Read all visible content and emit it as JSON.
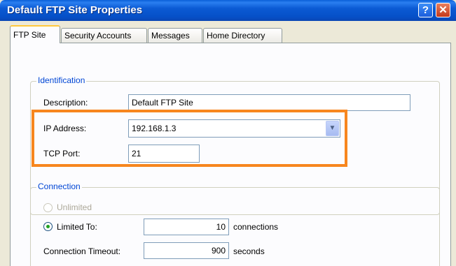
{
  "window": {
    "title": "Default FTP Site Properties",
    "help_glyph": "?",
    "close_glyph": "✕"
  },
  "tabs": [
    {
      "label": "FTP Site",
      "active": true
    },
    {
      "label": "Security Accounts",
      "active": false
    },
    {
      "label": "Messages",
      "active": false
    },
    {
      "label": "Home Directory",
      "active": false
    }
  ],
  "identification": {
    "legend": "Identification",
    "description_label": "Description:",
    "description_value": "Default FTP Site",
    "ip_label": "IP Address:",
    "ip_value": "192.168.1.3",
    "port_label": "TCP Port:",
    "port_value": "21"
  },
  "connection": {
    "legend": "Connection",
    "unlimited_label": "Unlimited",
    "limited_label": "Limited To:",
    "limited_value": "10",
    "limited_unit": "connections",
    "timeout_label": "Connection Timeout:",
    "timeout_value": "900",
    "timeout_unit": "seconds"
  },
  "colors": {
    "highlight": "#f7861e",
    "titlebar": "#0a5fd8",
    "legend_text": "#0046d5"
  }
}
